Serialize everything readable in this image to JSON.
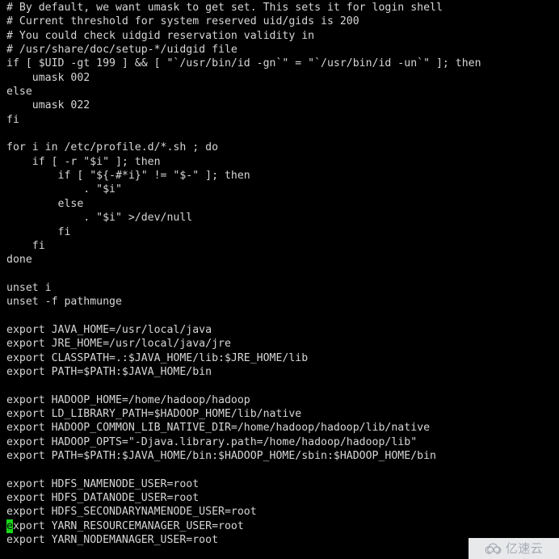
{
  "terminal": {
    "background_color": "#000000",
    "foreground_color": "#d6d6d6",
    "cursor_color": "#18d718",
    "cursor_line_index": 37,
    "cursor_char": "e",
    "lines": [
      "# By default, we want umask to get set. This sets it for login shell",
      "# Current threshold for system reserved uid/gids is 200",
      "# You could check uidgid reservation validity in",
      "# /usr/share/doc/setup-*/uidgid file",
      "if [ $UID -gt 199 ] && [ \"`/usr/bin/id -gn`\" = \"`/usr/bin/id -un`\" ]; then",
      "    umask 002",
      "else",
      "    umask 022",
      "fi",
      "",
      "for i in /etc/profile.d/*.sh ; do",
      "    if [ -r \"$i\" ]; then",
      "        if [ \"${-#*i}\" != \"$-\" ]; then",
      "            . \"$i\"",
      "        else",
      "            . \"$i\" >/dev/null",
      "        fi",
      "    fi",
      "done",
      "",
      "unset i",
      "unset -f pathmunge",
      "",
      "export JAVA_HOME=/usr/local/java",
      "export JRE_HOME=/usr/local/java/jre",
      "export CLASSPATH=.:$JAVA_HOME/lib:$JRE_HOME/lib",
      "export PATH=$PATH:$JAVA_HOME/bin",
      "",
      "export HADOOP_HOME=/home/hadoop/hadoop",
      "export LD_LIBRARY_PATH=$HADOOP_HOME/lib/native",
      "export HADOOP_COMMON_LIB_NATIVE_DIR=/home/hadoop/hadoop/lib/native",
      "export HADOOP_OPTS=\"-Djava.library.path=/home/hadoop/hadoop/lib\"",
      "export PATH=$PATH:$JAVA_HOME/bin:$HADOOP_HOME/sbin:$HADOOP_HOME/bin",
      "",
      "export HDFS_NAMENODE_USER=root",
      "export HDFS_DATANODE_USER=root",
      "export HDFS_SECONDARYNAMENODE_USER=root",
      "export YARN_RESOURCEMANAGER_USER=root",
      "export YARN_NODEMANAGER_USER=root"
    ]
  },
  "watermark": {
    "text": "亿速云",
    "icon": "cloud-icon",
    "background_color": "#f2f3f5",
    "text_color": "#aeb4bd"
  }
}
